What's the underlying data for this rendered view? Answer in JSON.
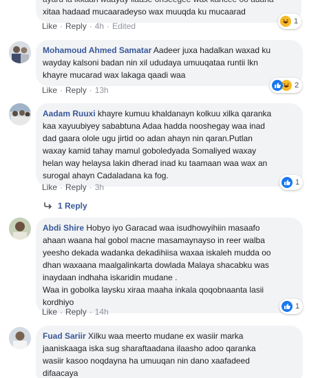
{
  "comments": [
    {
      "author": "",
      "lines": [
        "ayaru la ikkaan waayay ilaase onseegee wax kancee oo adaha",
        "xitaa hadaad mucaaradeyso wax muuqda ku mucaarad"
      ],
      "like": "Like",
      "reply": "Reply",
      "time": "4h",
      "edited": "Edited",
      "reactions": {
        "icons": [
          "haha"
        ],
        "count": "1"
      }
    },
    {
      "author": "Mohamoud Ahmed Samatar",
      "lines": [
        "Aadeer juxa hadalkan waxad ku",
        "wayday kalsoni badan nin xil ududaya umuuqataa runtii lkn",
        "khayre mucarad wax lakaga qaadi waa"
      ],
      "like": "Like",
      "reply": "Reply",
      "time": "13h",
      "reactions": {
        "icons": [
          "like",
          "haha"
        ],
        "count": "2"
      }
    },
    {
      "author": "Aadam Ruuxi",
      "lines": [
        "khayre kumuu khaldanayn kolkuu xilka qaranka",
        "kaa xayuubiyey sababtuna Adaa hadda nooshegay waa inad",
        "dad gaara olole ugu jirtid oo adan ahayn nin qaran.Putlan",
        "waxay kamid tahay mamul goboledyada Somaliyed waxay",
        "helan way helaysa lakin dherad inad ku taamaan waa wax an",
        "surogal ahayn Cadaladana ka fog."
      ],
      "like": "Like",
      "reply": "Reply",
      "time": "3h",
      "reactions": {
        "icons": [
          "like"
        ],
        "count": "1"
      },
      "replies_label": "1 Reply"
    },
    {
      "author": "Abdi Shire",
      "lines": [
        "Hobyo iyo Garacad waa isudhowyihiin masaafo",
        "ahaan waana hal gobol macne masamaynayso in reer walba",
        "yeesho dekada wadanka dekadihiisa waxaa iskaleh mudda oo",
        "dhan waxaana maalgalinkarta dowlada Malaya shacabku was",
        "inaydaan indhaha iskaridin mudane ."
      ],
      "lines2": [
        "Waa in gobolka laysku xiraa maaha inkala qoqobnaanta lasii",
        "kordhiyo"
      ],
      "like": "Like",
      "reply": "Reply",
      "time": "14h",
      "reactions": {
        "icons": [
          "like"
        ],
        "count": "1"
      }
    },
    {
      "author": "Fuad Sariir",
      "lines": [
        "Xilku waa meerto mudane ex wasiir marka",
        "jaaniskaaga iska sug sharaftaadana ilaasho adoo qaranka",
        "wasiir kasoo noqdayna ha umuuqan nin dano xaafadeed",
        "difaacaya"
      ]
    }
  ],
  "colors": {
    "link": "#385898",
    "bubble": "#f2f3f5",
    "like_blue": "#1877f2",
    "haha_yellow": "#f7b928"
  }
}
